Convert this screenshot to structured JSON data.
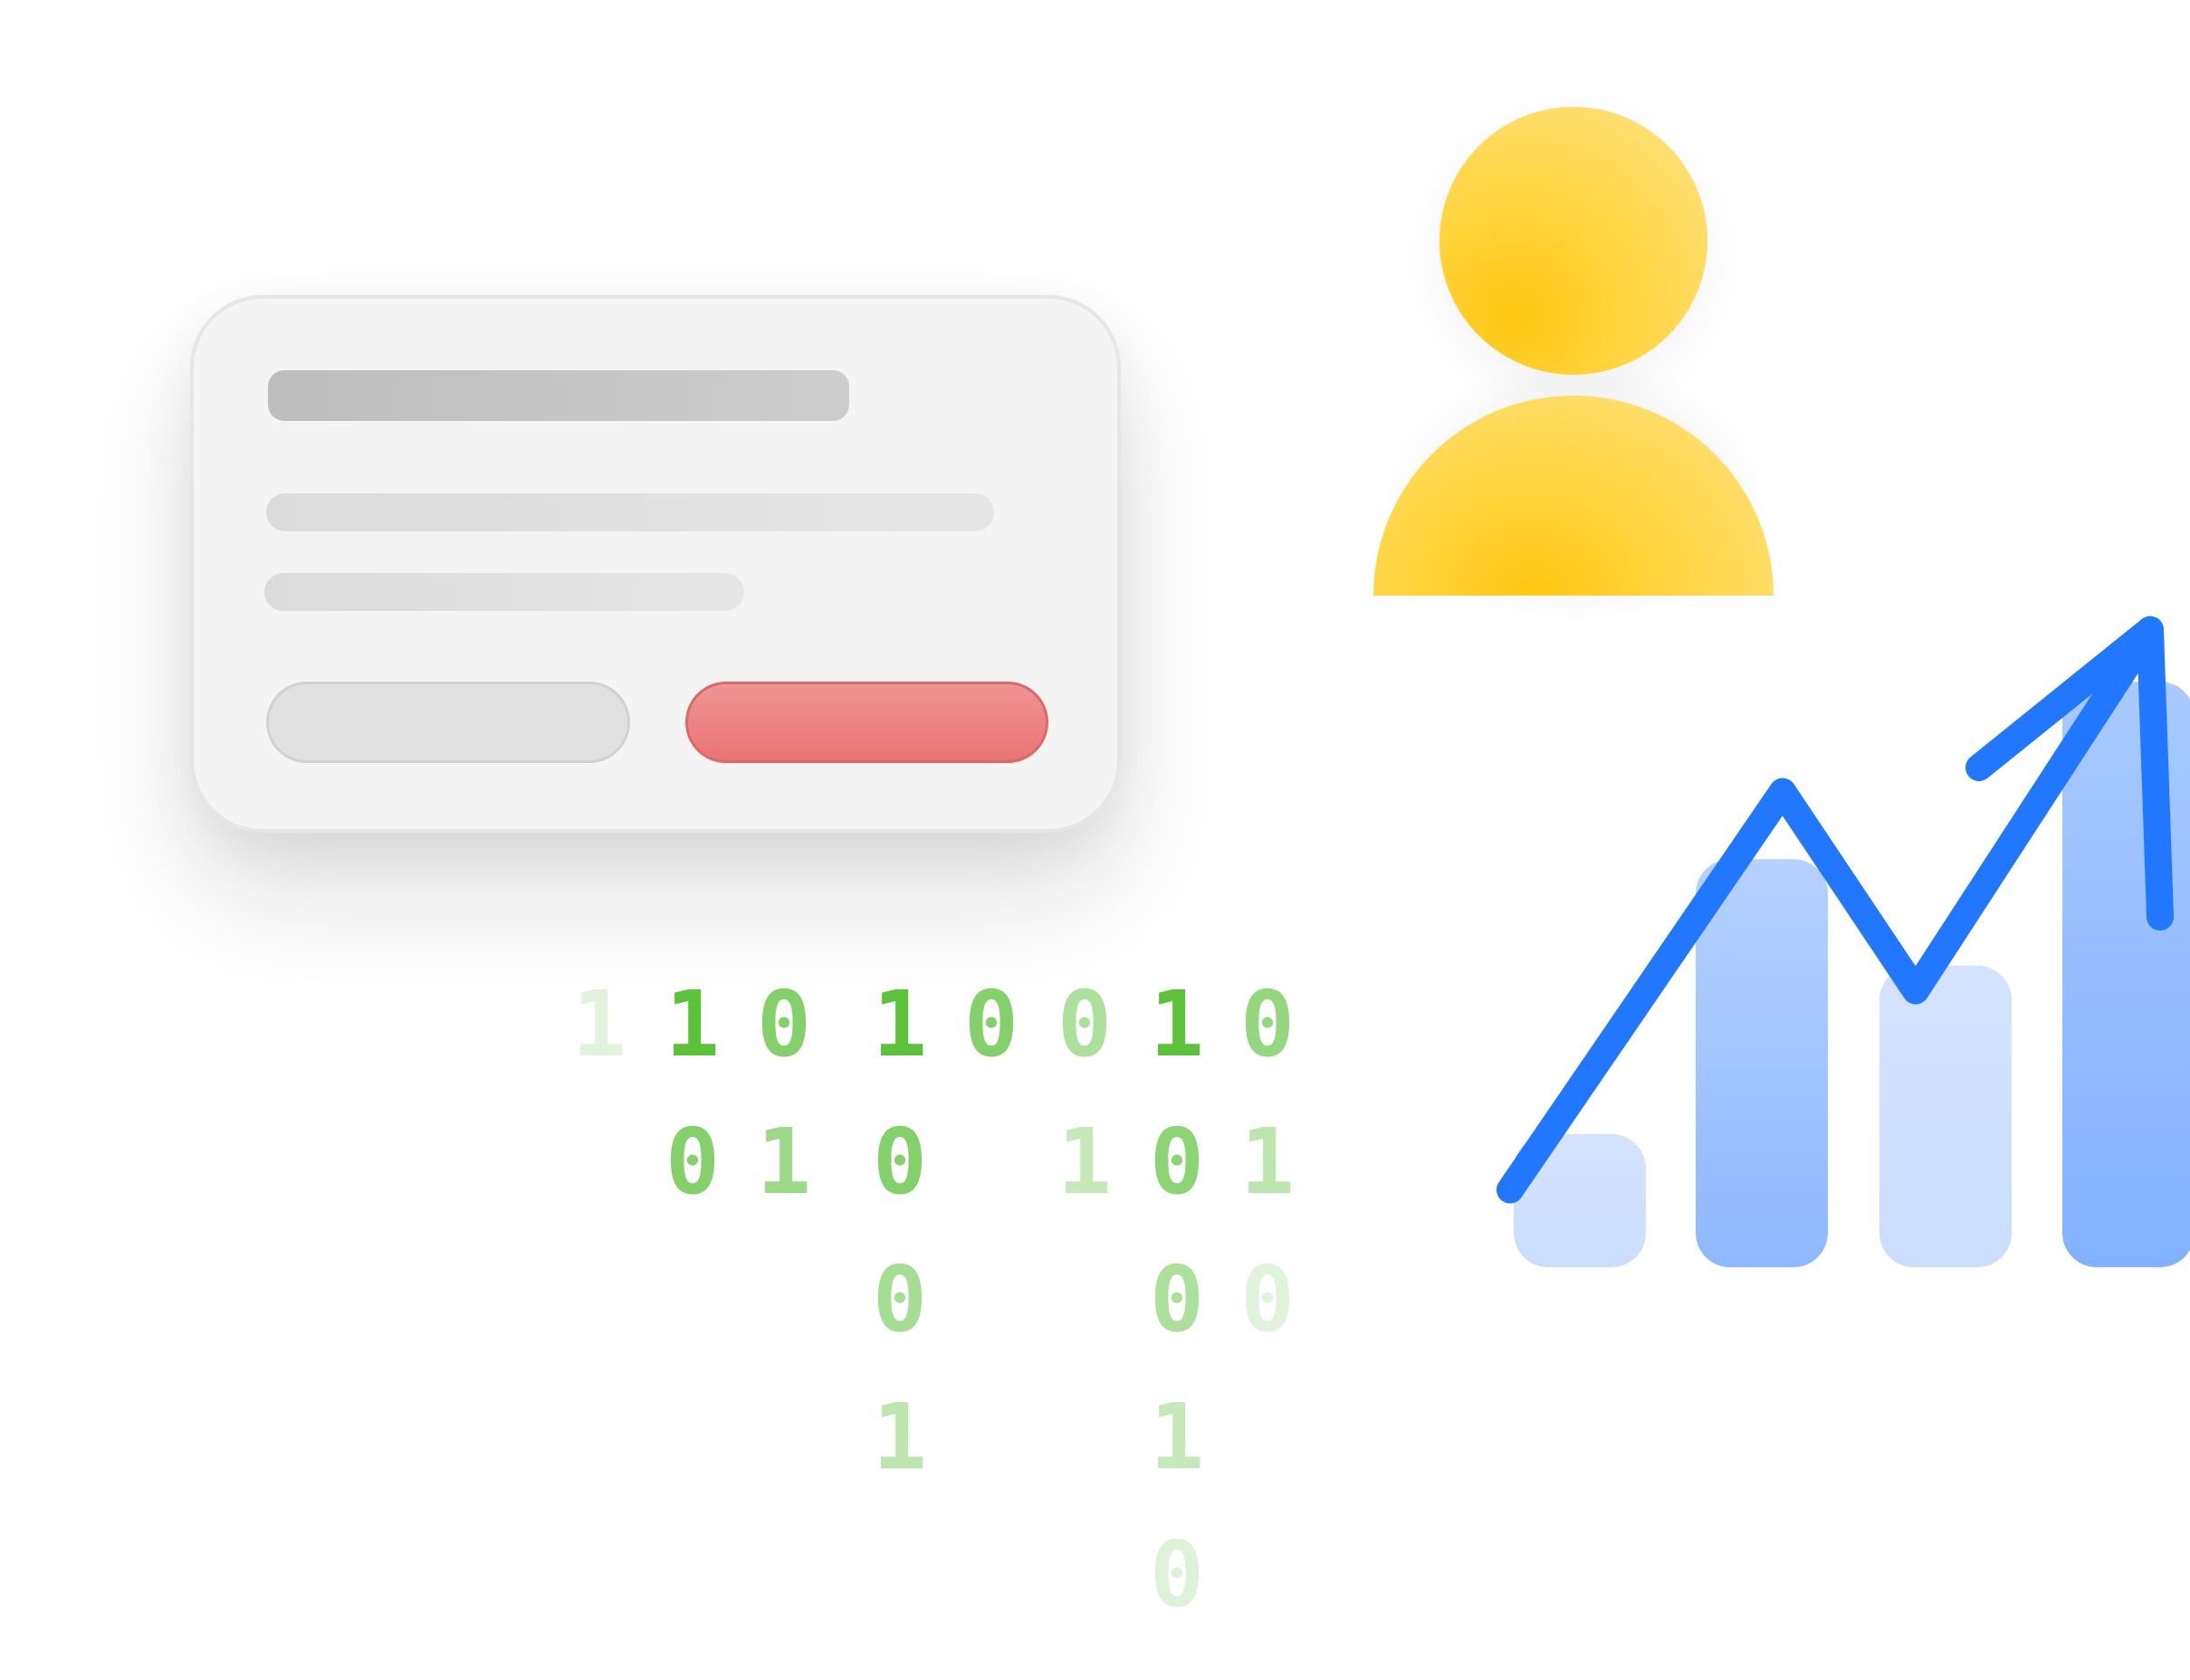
{
  "dialog": {
    "title_placeholder": "",
    "line_placeholders": [
      "",
      ""
    ],
    "cancel_label": "",
    "confirm_label": "",
    "confirm_color": "#ec7f7f",
    "cancel_color": "#e1e1e1"
  },
  "user": {
    "icon": "user-avatar-icon",
    "color": "#ffcc1a"
  },
  "binary": {
    "color": "#5cc23a",
    "columns": [
      [
        "1"
      ],
      [
        "1",
        "0"
      ],
      [
        "0",
        "1"
      ],
      [
        "1",
        "0",
        "0",
        "1"
      ],
      [
        "0"
      ],
      [
        "0",
        "1"
      ],
      [
        "1",
        "0",
        "0",
        "1",
        "0"
      ],
      [
        "0",
        "1",
        "0"
      ]
    ]
  },
  "chart_data": {
    "type": "bar",
    "bars": [
      {
        "value": 1.5,
        "shade": "light"
      },
      {
        "value": 4.6,
        "shade": "medium"
      },
      {
        "value": 3.4,
        "shade": "light"
      },
      {
        "value": 6.6,
        "shade": "medium"
      }
    ],
    "trend": [
      1,
      4.2,
      2.6,
      5.5
    ],
    "trend_color": "#2277ff",
    "bar_color": "#9ec2ff",
    "grid": false,
    "legend": "none"
  }
}
